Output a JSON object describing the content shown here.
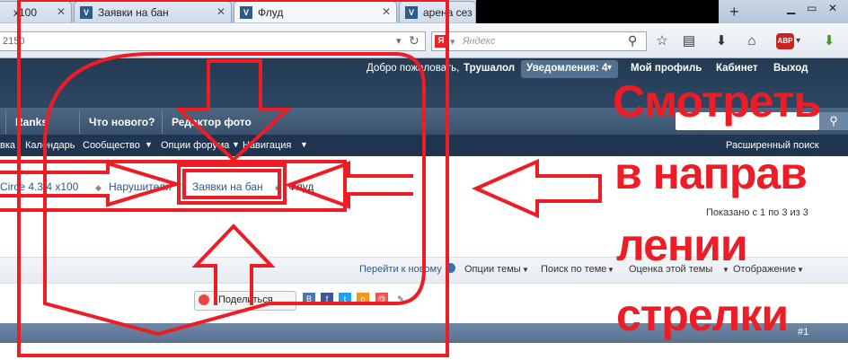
{
  "browser": {
    "tabs": [
      {
        "label": "x100"
      },
      {
        "label": "Заявки на бан"
      },
      {
        "label": "Флуд"
      },
      {
        "label": "арена сез"
      }
    ],
    "new_tab": "+",
    "url_fragment": "2150",
    "search_placeholder": "Яндекс",
    "search_engine_badge": "Я",
    "adblock_badge": "ABP"
  },
  "forum_header": {
    "welcome": "Добро пожаловать,",
    "username": "Трушалол",
    "notifications": "Уведомления: 4",
    "my_profile": "Мой профиль",
    "cabinet": "Кабинет",
    "logout": "Выход"
  },
  "nav_tabs": [
    "Ranks",
    "Что нового?",
    "Редактор фото"
  ],
  "sub_nav": [
    "вка",
    "Календарь",
    "Сообщество",
    "Опции форума",
    "Навигация"
  ],
  "advanced_search": "Расширенный поиск",
  "breadcrumb": [
    "Circe 4.3.4 x100",
    "Нарушители",
    "Заявки на бан",
    "Флуд"
  ],
  "results_text": "Показано с 1 по 3 из 3",
  "thread_tools": [
    "Перейти к новому",
    "Опции темы",
    "Поиск по теме",
    "Оценка этой темы",
    "Отображение"
  ],
  "share_button": "Поделиться",
  "post_number": "#1",
  "annotation": {
    "line1": "Смотреть",
    "line2": "в направ",
    "line3": "лении",
    "line4": "стрелки"
  },
  "colors": {
    "annotation_red": "#ee1c24",
    "forum_dark": "#243a52"
  }
}
